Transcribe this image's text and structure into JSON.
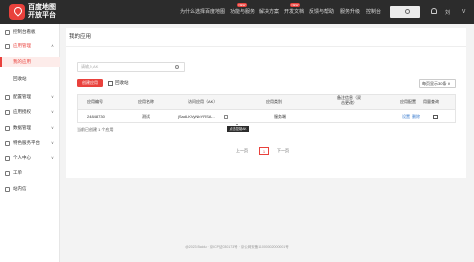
{
  "header": {
    "logo_line1": "百度地图",
    "logo_line2": "开放平台",
    "nav": [
      "为什么选择百度地图",
      "功能与服务",
      "解决方案",
      "开发文档",
      "反馈与帮助",
      "服务升级",
      "控制台"
    ],
    "new_badge": "NEW",
    "search_placeholder": "",
    "user": "刘",
    "user_menu": "V"
  },
  "sidebar": {
    "items": [
      {
        "label": "控制台看板",
        "icon": "dashboard-icon"
      },
      {
        "label": "应用管理",
        "icon": "app-icon",
        "arrow": "∧"
      },
      {
        "label": "我的应用",
        "sub": true,
        "active": true
      },
      {
        "label": "回收站",
        "sub": true
      },
      {
        "label": "配置管理",
        "icon": "config-icon",
        "arrow": "∨"
      },
      {
        "label": "应用授权",
        "icon": "auth-icon",
        "arrow": "∨"
      },
      {
        "label": "数据管理",
        "icon": "data-icon",
        "arrow": "∨"
      },
      {
        "label": "特色服务平台",
        "icon": "service-icon",
        "arrow": "∨"
      },
      {
        "label": "个人中心",
        "icon": "user-icon",
        "arrow": "∨"
      },
      {
        "label": "工单",
        "icon": "ticket-icon"
      },
      {
        "label": "站内信",
        "icon": "mail-icon"
      }
    ]
  },
  "main": {
    "title": "我的应用",
    "search_placeholder": "请输入AK",
    "create_button": "创建应用",
    "recycle_link": "回收站",
    "page_size": "每页显示30条 ∨",
    "columns": [
      "应用编号",
      "应用名称",
      "访问应用（AK）",
      "应用类别",
      "备注信息（双击更改）",
      "应用配置",
      "用量查询"
    ],
    "rows": [
      {
        "id": "24848730",
        "name": "测试",
        "ak": "jSadLKVyNbYRSA...",
        "category": "服务端",
        "note": "",
        "config_set": "设置",
        "config_delete": "删除",
        "usage": ""
      }
    ],
    "copy_tooltip": "点击复制AK",
    "count": "当前已创建 1 个应用",
    "pager": {
      "prev": "上一页",
      "current": "1",
      "next": "下一页"
    }
  },
  "footer": "@2023 Baidu · 京ICP证030173号 · 京公网安备11000002000001号"
}
